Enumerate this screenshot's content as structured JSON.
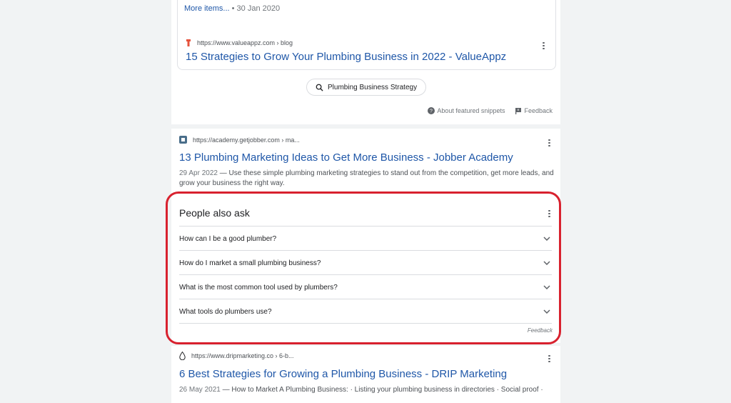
{
  "top_result": {
    "more_items": "More items...",
    "more_items_date": " • 30 Jan 2020",
    "url": "https://www.valueappz.com › blog",
    "title": "15 Strategies to Grow Your Plumbing Business in 2022 - ValueAppz"
  },
  "chip": {
    "label": "Plumbing Business Strategy",
    "icon": "search-icon"
  },
  "featured": {
    "about_label": "About featured snippets",
    "feedback_label": "Feedback"
  },
  "result_jobber": {
    "url": "https://academy.getjobber.com › ma...",
    "title": "13 Plumbing Marketing Ideas to Get More Business - Jobber Academy",
    "date": "29 Apr 2022",
    "snippet": " — Use these simple plumbing marketing strategies to stand out from the competition, get more leads, and grow your business the right way."
  },
  "people_also_ask": {
    "title": "People also ask",
    "questions": [
      "How can I be a good plumber?",
      "How do I market a small plumbing business?",
      "What is the most common tool used by plumbers?",
      "What tools do plumbers use?"
    ],
    "feedback": "Feedback"
  },
  "result_drip": {
    "url": "https://www.dripmarketing.co › 6-b...",
    "title": "6 Best Strategies for Growing a Plumbing Business - DRIP Marketing",
    "date": "26 May 2021",
    "snippet": " — How to Market A Plumbing Business: · Listing your plumbing business in directories · Social proof ·"
  },
  "colors": {
    "highlight": "#d8212e",
    "link": "#1f57a8"
  }
}
